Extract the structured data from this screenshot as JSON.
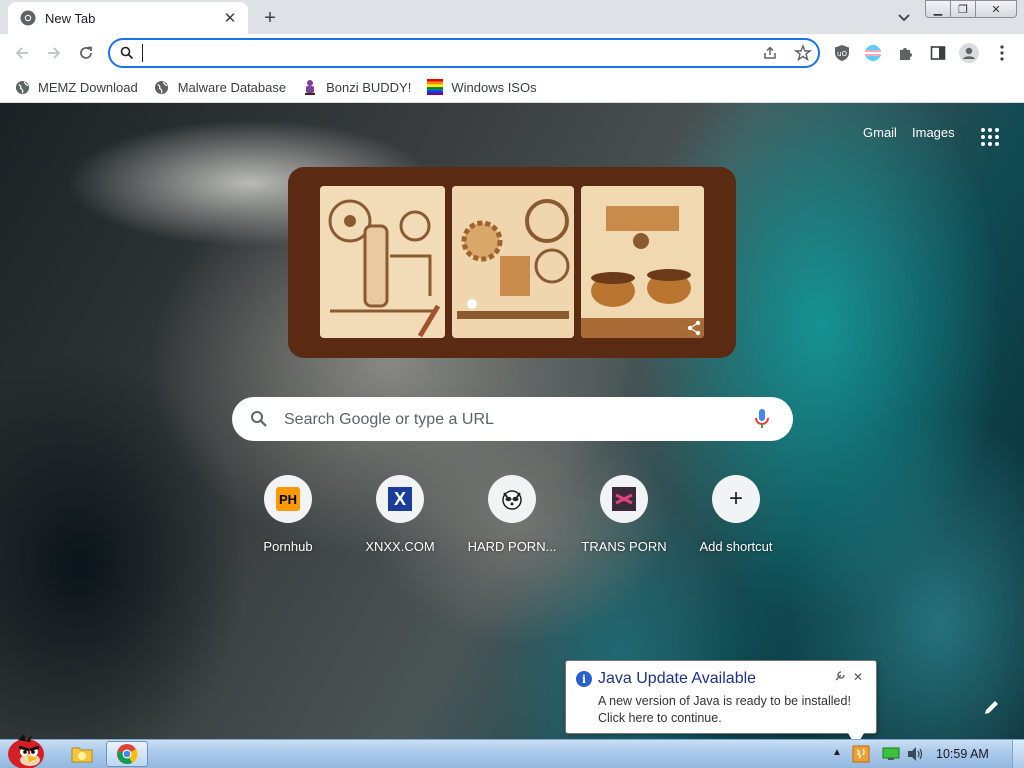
{
  "browser": {
    "tab": {
      "title": "New Tab"
    },
    "window_controls": [
      "minimize",
      "restore",
      "close"
    ],
    "omnibox": {
      "value": "",
      "placeholder": ""
    },
    "bookmarks": [
      {
        "label": "MEMZ Download",
        "icon": "globe-icon"
      },
      {
        "label": "Malware Database",
        "icon": "globe-icon"
      },
      {
        "label": "Bonzi BUDDY!",
        "icon": "bonzi-icon"
      },
      {
        "label": "Windows ISOs",
        "icon": "windows-flag-icon"
      }
    ]
  },
  "newtab": {
    "links": {
      "gmail": "Gmail",
      "images": "Images"
    },
    "search_placeholder": "Search Google or type a URL",
    "shortcuts": [
      {
        "label": "Pornhub",
        "icon_text": "PH"
      },
      {
        "label": "XNXX.COM",
        "icon_text": "X"
      },
      {
        "label": "HARD PORN...",
        "icon_text": ""
      },
      {
        "label": "TRANS PORN",
        "icon_text": ""
      },
      {
        "label": "Add shortcut",
        "icon_text": "+"
      }
    ]
  },
  "notification": {
    "title": "Java Update Available",
    "line1": "A new version of Java is ready to be installed!",
    "line2": "Click here to continue."
  },
  "taskbar": {
    "clock": "10:59 AM"
  },
  "colors": {
    "accent": "#1a73e8",
    "doodle_frame": "#5a2a12",
    "java_title": "#1e3287"
  }
}
